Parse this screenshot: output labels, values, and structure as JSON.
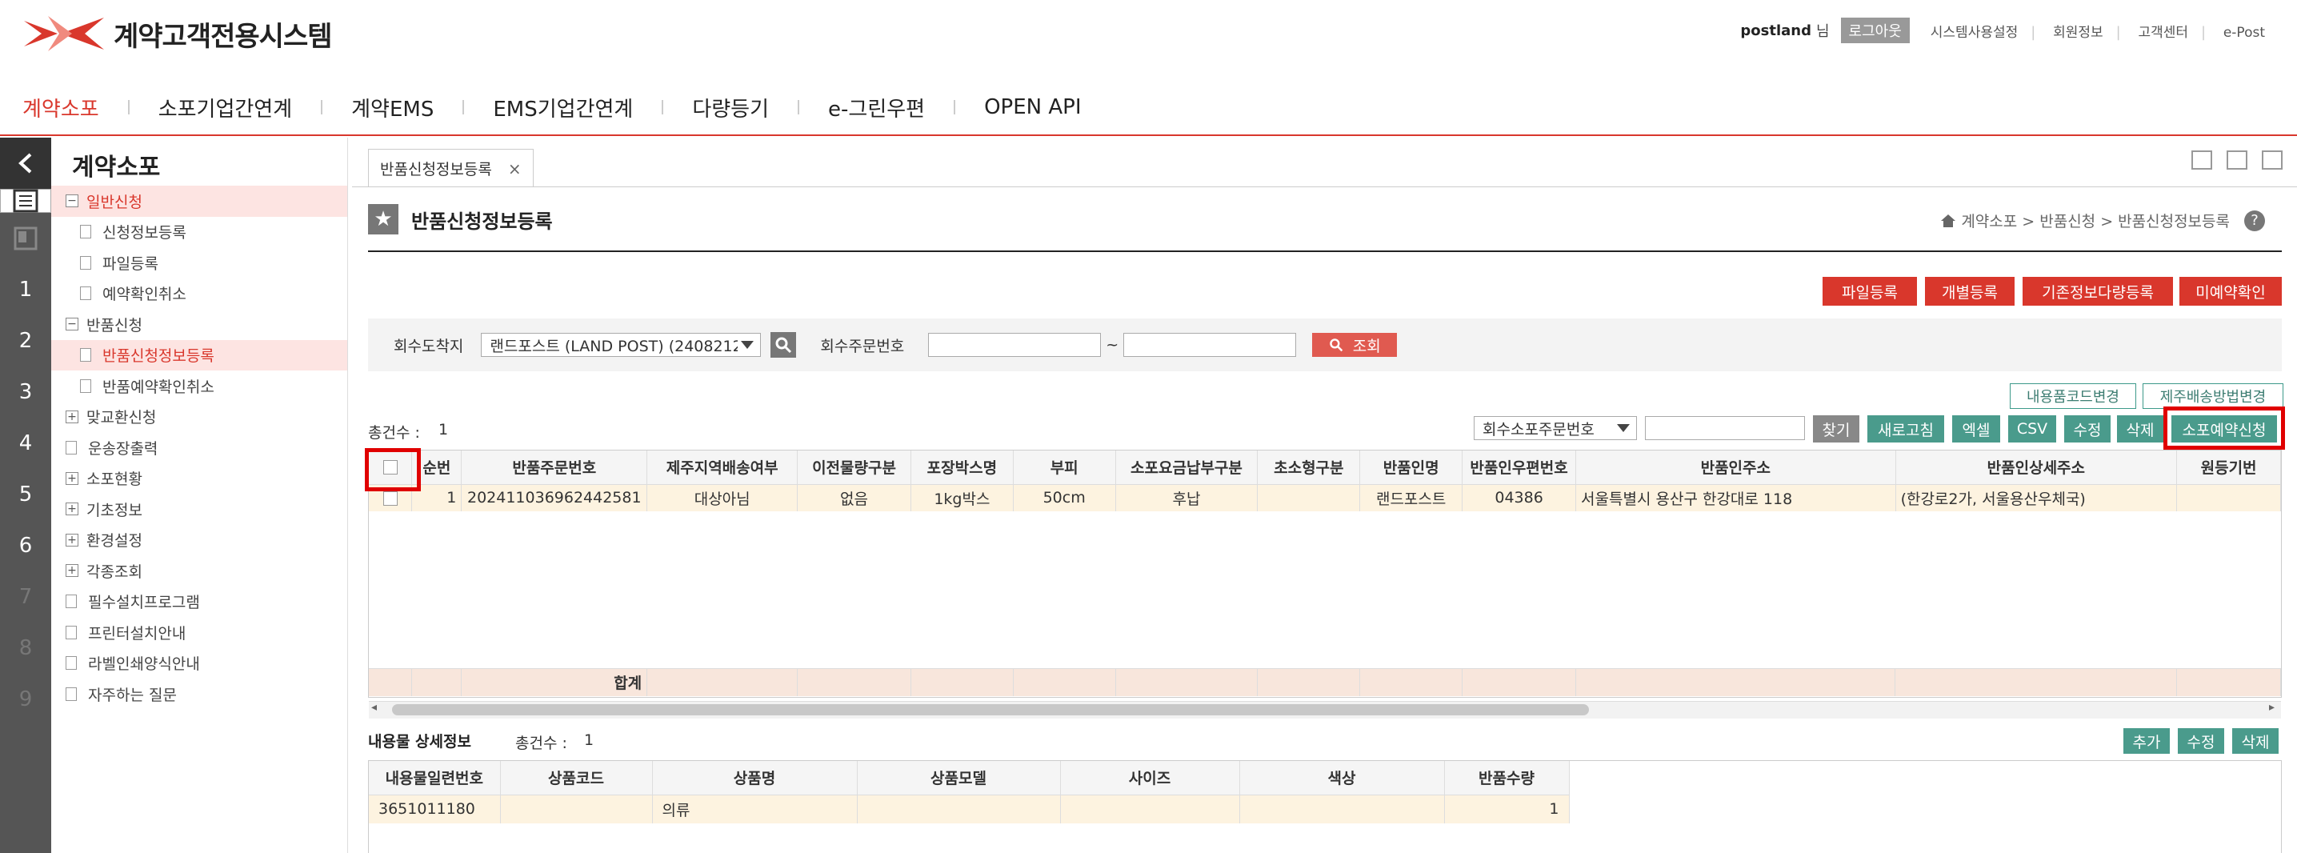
{
  "header": {
    "logo_text": "계약고객전용시스템",
    "user_name": "postland",
    "user_suffix": "님",
    "logout_label": "로그아웃",
    "util_links": [
      "시스템사용설정",
      "회원정보",
      "고객센터",
      "e-Post"
    ]
  },
  "gnb": {
    "items": [
      "계약소포",
      "소포기업간연계",
      "계약EMS",
      "EMS기업간연계",
      "다량등기",
      "e-그린우편",
      "OPEN API"
    ],
    "active_index": 0
  },
  "rail": {
    "numbers": [
      "1",
      "2",
      "3",
      "4",
      "5",
      "6",
      "7",
      "8",
      "9"
    ]
  },
  "sidebar": {
    "title": "계약소포",
    "items": [
      {
        "label": "일반신청",
        "level": 1,
        "type": "minus",
        "highlight": true
      },
      {
        "label": "신청정보등록",
        "level": 2,
        "type": "doc"
      },
      {
        "label": "파일등록",
        "level": 2,
        "type": "doc"
      },
      {
        "label": "예약확인취소",
        "level": 2,
        "type": "doc"
      },
      {
        "label": "반품신청",
        "level": 1,
        "type": "minus"
      },
      {
        "label": "반품신청정보등록",
        "level": 2,
        "type": "doc",
        "highlight": true
      },
      {
        "label": "반품예약확인취소",
        "level": 2,
        "type": "doc"
      },
      {
        "label": "맞교환신청",
        "level": 1,
        "type": "plus"
      },
      {
        "label": "운송장출력",
        "level": 1,
        "type": "doc"
      },
      {
        "label": "소포현황",
        "level": 1,
        "type": "plus"
      },
      {
        "label": "기초정보",
        "level": 1,
        "type": "plus"
      },
      {
        "label": "환경설정",
        "level": 1,
        "type": "plus"
      },
      {
        "label": "각종조회",
        "level": 1,
        "type": "plus"
      },
      {
        "label": "필수설치프로그램",
        "level": 1,
        "type": "doc"
      },
      {
        "label": "프린터설치안내",
        "level": 1,
        "type": "doc"
      },
      {
        "label": "라벨인쇄양식안내",
        "level": 1,
        "type": "doc"
      },
      {
        "label": "자주하는 질문",
        "level": 1,
        "type": "doc"
      }
    ]
  },
  "tab": {
    "label": "반품신청정보등록",
    "close": "×"
  },
  "page": {
    "title": "반품신청정보등록",
    "breadcrumb": "계약소포 > 반품신청 > 반품신청정보등록",
    "help": "?"
  },
  "top_buttons": [
    "파일등록",
    "개별등록",
    "기존정보다량등록",
    "미예약확인"
  ],
  "search": {
    "dest_label": "회수도착지",
    "dest_value": "랜드포스트 (LAND POST) (2408212",
    "order_label": "회수주문번호",
    "tilde": "~",
    "search_button": "조회"
  },
  "option_buttons": [
    "내용품코드변경",
    "제주배송방법변경"
  ],
  "toolbar": {
    "total_label": "총건수 :",
    "total_value": "1",
    "find_select": "회수소포주문번호",
    "buttons": [
      "찾기",
      "새로고침",
      "엑셀",
      "CSV",
      "수정",
      "삭제",
      "소포예약신청"
    ]
  },
  "grid": {
    "columns": [
      "순번",
      "반품주문번호",
      "제주지역배송여부",
      "이전물량구분",
      "포장박스명",
      "부피",
      "소포요금납부구분",
      "초소형구분",
      "반품인명",
      "반품인우편번호",
      "반품인주소",
      "반품인상세주소",
      "원등기번"
    ],
    "rows": [
      [
        "1",
        "202411036962442581",
        "대상아님",
        "없음",
        "1kg박스",
        "50cm",
        "후납",
        "",
        "랜드포스트",
        "04386",
        "서울특별시 용산구 한강대로 118",
        "(한강로2가, 서울용산우체국)",
        ""
      ]
    ],
    "sum_label": "합계"
  },
  "detail": {
    "title": "내용물 상세정보",
    "total_label": "총건수 :",
    "total_value": "1",
    "buttons": [
      "추가",
      "수정",
      "삭제"
    ],
    "columns": [
      "내용물일련번호",
      "상품코드",
      "상품명",
      "상품모델",
      "사이즈",
      "색상",
      "반품수량"
    ],
    "rows": [
      [
        "3651011180",
        "",
        "의류",
        "",
        "",
        "",
        "1"
      ]
    ]
  },
  "colors": {
    "accent": "#d9372c",
    "teal": "#4a9b8c",
    "highlight_row": "#fdf3e0"
  }
}
